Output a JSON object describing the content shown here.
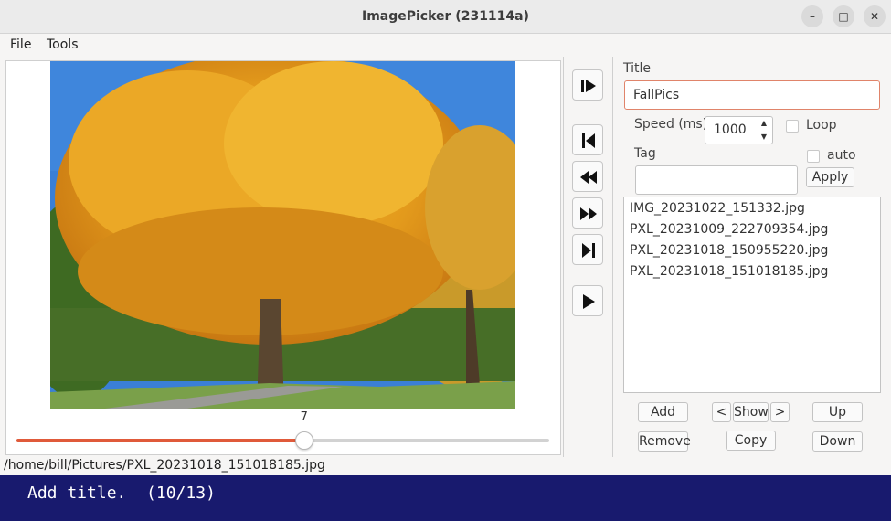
{
  "window": {
    "title": "ImagePicker (231114a)",
    "minimize_glyph": "–",
    "maximize_glyph": "□",
    "close_glyph": "✕"
  },
  "menu": {
    "file": "File",
    "tools": "Tools"
  },
  "viewer": {
    "slider_value": "7",
    "slider_fraction": 0.54,
    "status_path": "/home/bill/Pictures/PXL_20231018_151018185.jpg"
  },
  "transport": {
    "icons": [
      "step-play-icon",
      "first-icon",
      "rewind-icon",
      "fast-forward-icon",
      "last-icon",
      "play-icon"
    ]
  },
  "panel": {
    "title_label": "Title",
    "title_value": "FallPics",
    "speed_label": "Speed (ms)",
    "speed_value": "1000",
    "loop_label": "Loop",
    "tag_label": "Tag",
    "auto_label": "auto",
    "apply_label": "Apply",
    "files": [
      "IMG_20231022_151332.jpg",
      "PXL_20231009_222709354.jpg",
      "PXL_20231018_150955220.jpg",
      "PXL_20231018_151018185.jpg"
    ],
    "add_label": "Add",
    "prev_label": "<",
    "show_label": "Show",
    "next_label": ">",
    "up_label": "Up",
    "remove_label": "Remove",
    "copy_label": "Copy",
    "down_label": "Down"
  },
  "banner": {
    "text": "Add title.  (10/13)"
  },
  "colors": {
    "accent": "#e05a3a",
    "banner_bg": "#181a6e",
    "focus_border": "#e0846a"
  }
}
